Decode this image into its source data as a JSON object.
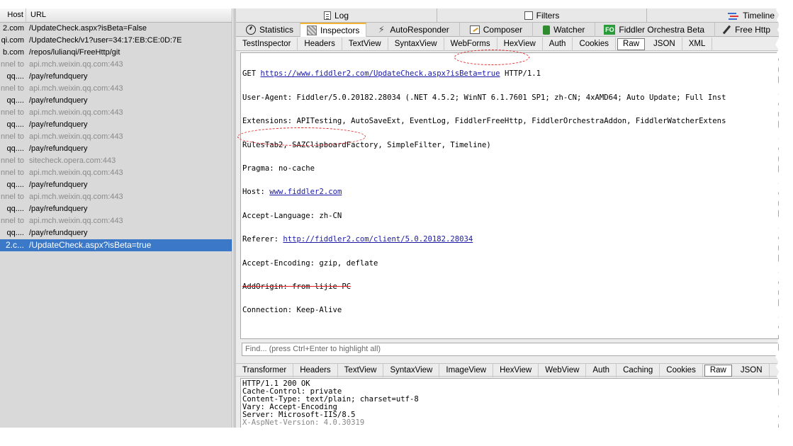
{
  "sessions": {
    "columns": {
      "host": "Host",
      "url": "URL"
    },
    "rows": [
      {
        "host": "2.com",
        "url": "/UpdateCheck.aspx?isBeta=False",
        "tunnel": false
      },
      {
        "host": "qi.com",
        "url": "/UpdateCheck/v1?user=34:17:EB:CE:0D:7E",
        "tunnel": false
      },
      {
        "host": "b.com",
        "url": "/repos/lulianqi/FreeHttp/git",
        "tunnel": false
      },
      {
        "host": "nnel to",
        "url": "api.mch.weixin.qq.com:443",
        "tunnel": true
      },
      {
        "host": "qq....",
        "url": "/pay/refundquery",
        "tunnel": false
      },
      {
        "host": "nnel to",
        "url": "api.mch.weixin.qq.com:443",
        "tunnel": true
      },
      {
        "host": "qq....",
        "url": "/pay/refundquery",
        "tunnel": false
      },
      {
        "host": "nnel to",
        "url": "api.mch.weixin.qq.com:443",
        "tunnel": true
      },
      {
        "host": "qq....",
        "url": "/pay/refundquery",
        "tunnel": false
      },
      {
        "host": "nnel to",
        "url": "api.mch.weixin.qq.com:443",
        "tunnel": true
      },
      {
        "host": "qq....",
        "url": "/pay/refundquery",
        "tunnel": false
      },
      {
        "host": "nnel to",
        "url": "sitecheck.opera.com:443",
        "tunnel": true
      },
      {
        "host": "nnel to",
        "url": "api.mch.weixin.qq.com:443",
        "tunnel": true
      },
      {
        "host": "qq....",
        "url": "/pay/refundquery",
        "tunnel": false
      },
      {
        "host": "nnel to",
        "url": "api.mch.weixin.qq.com:443",
        "tunnel": true
      },
      {
        "host": "qq....",
        "url": "/pay/refundquery",
        "tunnel": false
      },
      {
        "host": "nnel to",
        "url": "api.mch.weixin.qq.com:443",
        "tunnel": true
      },
      {
        "host": "qq....",
        "url": "/pay/refundquery",
        "tunnel": false
      },
      {
        "host": "2.c...",
        "url": "/UpdateCheck.aspx?isBeta=true",
        "tunnel": false,
        "selected": true
      }
    ]
  },
  "top_tabs": {
    "log": "Log",
    "filters": "Filters",
    "timeline": "Timeline"
  },
  "main_tabs": {
    "statistics": "Statistics",
    "inspectors": "Inspectors",
    "autoresponder": "AutoResponder",
    "composer": "Composer",
    "watcher": "Watcher",
    "fo_badge": "FO",
    "orchestra": "Fiddler Orchestra Beta",
    "freehttp": "Free Http"
  },
  "request_tabs": [
    "TestInspector",
    "Headers",
    "TextView",
    "SyntaxView",
    "WebForms",
    "HexView",
    "Auth",
    "Cookies",
    "Raw",
    "JSON",
    "XML"
  ],
  "request_raw": {
    "line1_method": "GET ",
    "line1_url": "https://www.fiddler2.com/UpdateCheck.aspx?isBeta=true",
    "line1_version": " HTTP/1.1",
    "user_agent": "User-Agent: Fiddler/5.0.20182.28034 (.NET 4.5.2; WinNT 6.1.7601 SP1; zh-CN; 4xAMD64; Auto Update; Full Inst",
    "extensions": "Extensions: APITesting, AutoSaveExt, EventLog, FiddlerFreeHttp, FiddlerOrchestraAddon, FiddlerWatcherExtens",
    "rules": "RulesTab2, SAZClipboardFactory, SimpleFilter, Timeline)",
    "pragma": "Pragma: no-cache",
    "host_label": "Host: ",
    "host_link": "www.fiddler2.com",
    "accept_language": "Accept-Language: zh-CN",
    "referer_label": "Referer: ",
    "referer_link": "http://fiddler2.com/client/5.0.20182.28034",
    "accept_encoding": "Accept-Encoding: gzip, deflate",
    "addorigin": "AddOrigin: from lijie PC",
    "connection": "Connection: Keep-Alive"
  },
  "find": {
    "placeholder": "Find... (press Ctrl+Enter to highlight all)"
  },
  "response_tabs": [
    "Transformer",
    "Headers",
    "TextView",
    "SyntaxView",
    "ImageView",
    "HexView",
    "WebView",
    "Auth",
    "Caching",
    "Cookies",
    "Raw",
    "JSON"
  ],
  "response_raw": [
    "HTTP/1.1 200 OK",
    "Cache-Control: private",
    "Content-Type: text/plain; charset=utf-8",
    "Vary: Accept-Encoding",
    "Server: Microsoft-IIS/8.5",
    "X-AspNet-Version: 4.0.30319"
  ],
  "colors": {
    "selection": "#3b78c7",
    "link": "#1a1aa6",
    "annotation": "#e02020",
    "active_tab_accent": "#f2b233"
  }
}
